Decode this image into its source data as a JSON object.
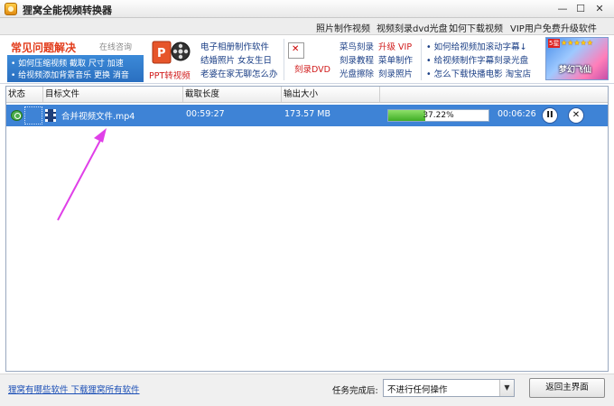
{
  "window": {
    "title": "狸窝全能视频转换器",
    "min_glyph": "—",
    "max_glyph": "☐",
    "close_glyph": "✕"
  },
  "toplinks": [
    "照片制作视频",
    "视频刻录dvd光盘",
    "如何下载视频",
    "VIP用户免费升级软件"
  ],
  "ads": {
    "faq_title": "常见问题解决",
    "faq_online": "在线咨询",
    "faq_line1": "• 如何压缩视频  截取  尺寸  加速",
    "faq_line2": "• 给视频添加背景音乐  更换  消音",
    "ppt_label": "PPT转视频",
    "col2": [
      "电子相册制作软件",
      "结婚照片  女友生日",
      "老婆在家无聊怎么办"
    ],
    "dvd_label": "刻录DVD",
    "col3a": [
      "菜鸟刻录",
      "刻录教程",
      "光盘擦除"
    ],
    "col3b_vip": "升级 VIP",
    "col3b": [
      "菜单制作",
      "刻录照片"
    ],
    "col4": [
      "• 如何给视频加滚动字幕↓",
      "• 给视频制作字幕刻录光盘",
      "• 怎么下载快播电影  淘宝店"
    ],
    "game_level": "5星",
    "game_stars": "★★★★★",
    "game_title": "梦幻飞仙"
  },
  "table": {
    "headers": {
      "status": "状态",
      "target_file": "目标文件",
      "clip_length": "截取长度",
      "output_size": "输出大小"
    },
    "rows": [
      {
        "file_name": "合并视频文件.mp4",
        "length": "00:59:27",
        "size": "173.57 MB",
        "progress_value": 37.22,
        "progress_text": "37.22%",
        "remaining": "00:06:26",
        "pause_glyph": "II",
        "cancel_glyph": "✕"
      }
    ]
  },
  "bottom": {
    "link": "狸窝有哪些软件 下载狸窝所有软件",
    "after_label": "任务完成后:",
    "after_value": "不进行任何操作",
    "home_button": "返回主界面"
  },
  "colors": {
    "selection": "#3e83d6",
    "progress": "#3fae25",
    "annotation_arrow": "#e040e8"
  }
}
